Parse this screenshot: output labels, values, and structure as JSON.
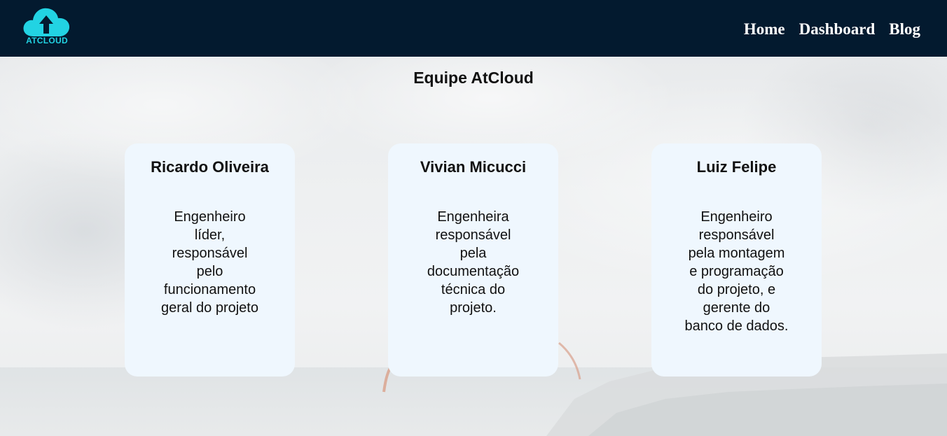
{
  "header": {
    "logo_text": "ATCLOUD",
    "nav": [
      {
        "label": "Home"
      },
      {
        "label": "Dashboard"
      },
      {
        "label": "Blog"
      }
    ]
  },
  "main": {
    "title": "Equipe AtCloud",
    "team": [
      {
        "name": "Ricardo Oliveira",
        "description": "Engenheiro líder, responsável pelo funcionamento geral do projeto"
      },
      {
        "name": "Vivian Micucci",
        "description": "Engenheira responsável pela documentação técnica do projeto."
      },
      {
        "name": "Luiz Felipe",
        "description": "Engenheiro responsável pela montagem e programação do projeto, e gerente do banco de dados."
      }
    ]
  },
  "colors": {
    "header_bg": "#031a2f",
    "logo_accent": "#22d3e3",
    "card_bg": "#eff7fe"
  }
}
